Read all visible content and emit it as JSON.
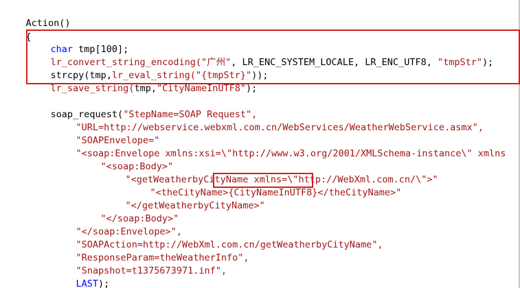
{
  "code": {
    "action": "Action()",
    "open_brace": "{",
    "block1": {
      "l1_kw": "char",
      "l1_rest": " tmp[100];",
      "l2_fn": "lr_convert_string_encoding(",
      "l2_str1": "\"广州\"",
      "l2_rest1": ", LR_ENC_SYSTEM_LOCALE, LR_ENC_UTF8, ",
      "l2_str2": "\"tmpStr\"",
      "l2_rest2": ");",
      "l3_plain": "strcpy(tmp,",
      "l3_fn": "lr_eval_string(",
      "l3_str": "\"{tmpStr}\"",
      "l3_rest": "));",
      "l4_fn": "lr_save_string(",
      "l4_plain": "tmp,",
      "l4_str": "\"CityNameInUTF8\"",
      "l4_rest": ");"
    },
    "soap": {
      "s1_plain": "soap_request(",
      "s1_str": "\"StepName=SOAP Request\",",
      "s2_str": "\"URL=http://webservice.webxml.com.cn/WebServices/WeatherWebService.asmx\",",
      "s3_str": "\"SOAPEnvelope=\"",
      "s4_str": "\"<soap:Envelope xmlns:xsi=\\\"http://www.w3.org/2001/XMLSchema-instance\\\" xmlns",
      "s5_str": "\"<soap:Body>\"",
      "s6_str": "\"<getWeatherbyCityName xmlns=\\\"http://WebXml.com.cn/\\\">\"",
      "s7_str1": "\"<theCityName>",
      "s7_param": "{CityNameInUTF8}",
      "s7_str2": "</theCityName>\"",
      "s8_str": "\"</getWeatherbyCityName>\"",
      "s9_str": "\"</soap:Body>\"",
      "s10_str": "\"</soap:Envelope>\",",
      "s11_str": "\"SOAPAction=http://WebXml.com.cn/getWeatherbyCityName\",",
      "s12_str": "\"ResponseParam=theWeatherInfo\",",
      "s13_str": "\"Snapshot=t1375673971.inf\",",
      "s14_kw": "LAST",
      "s14_rest": ");"
    }
  },
  "colors": {
    "keyword": "#0000ff",
    "string": "#a31515",
    "text": "#000000",
    "highlight_box": "#d21f1f"
  }
}
